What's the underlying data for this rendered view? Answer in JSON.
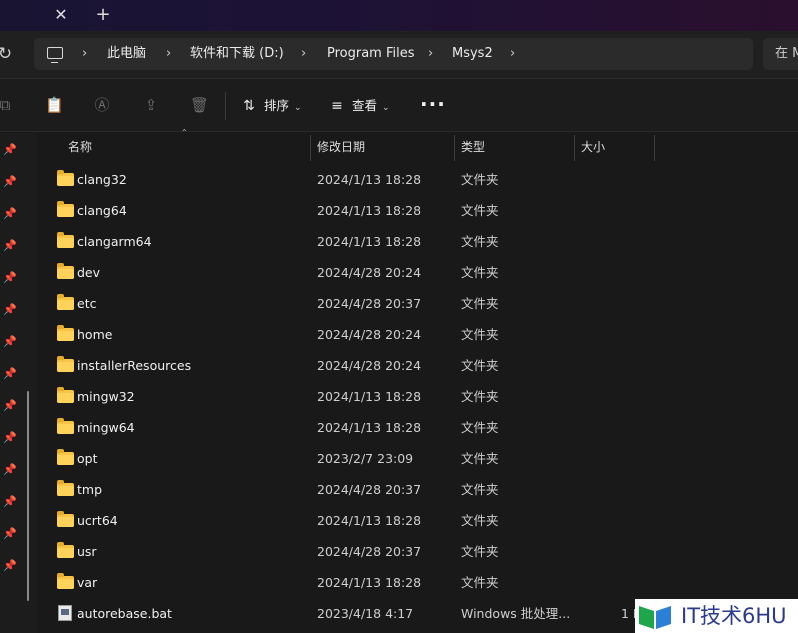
{
  "window": {
    "tab_close_icon": "close-icon",
    "tab_new_icon": "plus-icon"
  },
  "address_bar": {
    "breadcrumbs": [
      "此电脑",
      "软件和下载 (D:)",
      "Program Files",
      "Msys2"
    ],
    "search_placeholder": "在 M"
  },
  "toolbar": {
    "sort_label": "排序",
    "view_label": "查看",
    "more_label": "···"
  },
  "columns": {
    "name": "名称",
    "date": "修改日期",
    "type": "类型",
    "size": "大小"
  },
  "files": [
    {
      "name": "clang32",
      "date": "2024/1/13 18:28",
      "type": "文件夹",
      "size": "",
      "icon": "folder-icon"
    },
    {
      "name": "clang64",
      "date": "2024/1/13 18:28",
      "type": "文件夹",
      "size": "",
      "icon": "folder-icon"
    },
    {
      "name": "clangarm64",
      "date": "2024/1/13 18:28",
      "type": "文件夹",
      "size": "",
      "icon": "folder-icon"
    },
    {
      "name": "dev",
      "date": "2024/4/28 20:24",
      "type": "文件夹",
      "size": "",
      "icon": "folder-icon"
    },
    {
      "name": "etc",
      "date": "2024/4/28 20:37",
      "type": "文件夹",
      "size": "",
      "icon": "folder-icon"
    },
    {
      "name": "home",
      "date": "2024/4/28 20:24",
      "type": "文件夹",
      "size": "",
      "icon": "folder-icon"
    },
    {
      "name": "installerResources",
      "date": "2024/4/28 20:24",
      "type": "文件夹",
      "size": "",
      "icon": "folder-icon"
    },
    {
      "name": "mingw32",
      "date": "2024/1/13 18:28",
      "type": "文件夹",
      "size": "",
      "icon": "folder-icon"
    },
    {
      "name": "mingw64",
      "date": "2024/1/13 18:28",
      "type": "文件夹",
      "size": "",
      "icon": "folder-icon"
    },
    {
      "name": "opt",
      "date": "2023/2/7 23:09",
      "type": "文件夹",
      "size": "",
      "icon": "folder-icon"
    },
    {
      "name": "tmp",
      "date": "2024/4/28 20:37",
      "type": "文件夹",
      "size": "",
      "icon": "folder-icon"
    },
    {
      "name": "ucrt64",
      "date": "2024/1/13 18:28",
      "type": "文件夹",
      "size": "",
      "icon": "folder-icon"
    },
    {
      "name": "usr",
      "date": "2024/4/28 20:37",
      "type": "文件夹",
      "size": "",
      "icon": "folder-icon"
    },
    {
      "name": "var",
      "date": "2024/1/13 18:28",
      "type": "文件夹",
      "size": "",
      "icon": "folder-icon"
    },
    {
      "name": "autorebase.bat",
      "date": "2023/4/18 4:17",
      "type": "Windows 批处理...",
      "size": "1 K",
      "icon": "batch-file-icon"
    }
  ],
  "watermark": {
    "text": "IT技术6HU"
  },
  "colors": {
    "folder": "#f6c344",
    "background": "#191919",
    "watermark_text": "#2b3a8c"
  }
}
